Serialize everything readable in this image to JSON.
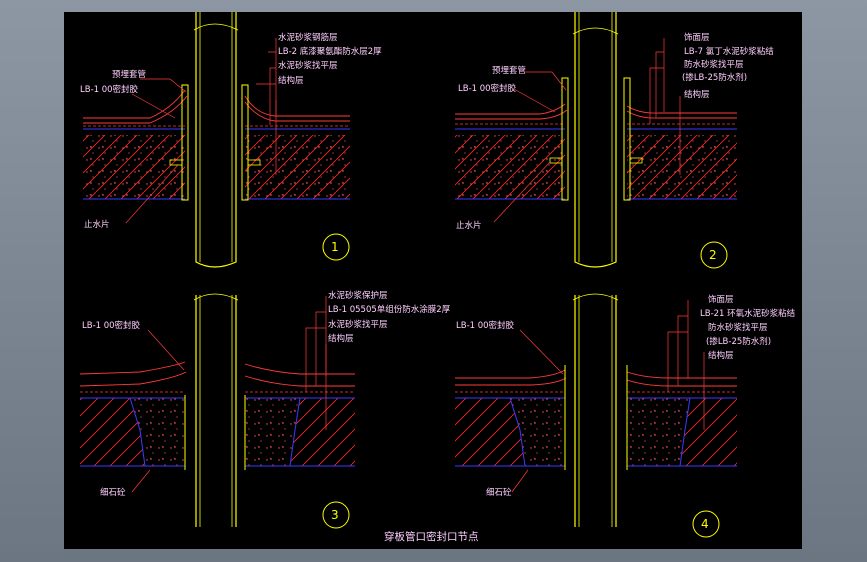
{
  "title": "穿板管口密封口节点",
  "details": [
    {
      "number": "1",
      "left_labels": [
        "预埋套管",
        "LB-1 00密封胶",
        "止水片"
      ],
      "right_labels": [
        "水泥砂浆钢筋层",
        "LB-2 底漆聚氨酯防水层2厚",
        "水泥砂浆找平层",
        "结构层"
      ]
    },
    {
      "number": "2",
      "left_labels": [
        "预埋套管",
        "LB-1 00密封胶",
        "止水片"
      ],
      "right_labels": [
        "饰面层",
        "LB-7 氯丁水泥砂浆粘结",
        "防水砂浆找平层",
        "(掺LB-25防水剂)",
        "结构层"
      ]
    },
    {
      "number": "3",
      "left_labels": [
        "LB-1 00密封胶",
        "细石砼"
      ],
      "right_labels": [
        "水泥砂浆保护层",
        "LB-1 05505单组份防水涂膜2厚",
        "水泥砂浆找平层",
        "结构层"
      ]
    },
    {
      "number": "4",
      "left_labels": [
        "LB-1 00密封胶",
        "细石砼"
      ],
      "right_labels": [
        "饰面层",
        "LB-21 环氧水泥砂浆粘结",
        "防水砂浆找平层",
        "(掺LB-25防水剂)",
        "结构层"
      ]
    }
  ],
  "colors": {
    "sheet": "#000000",
    "frame": "#7f8a97",
    "pipe": "#ffff00",
    "hatch": "#ff2a2a",
    "blue_line": "#3a3aff",
    "label": "#ffd0ff"
  }
}
